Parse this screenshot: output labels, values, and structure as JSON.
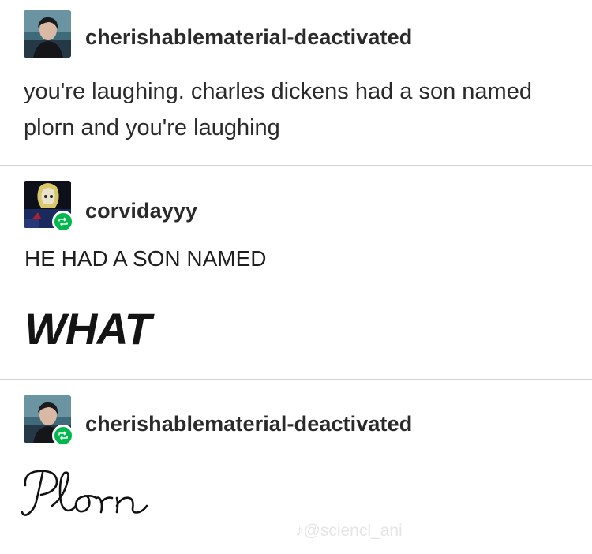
{
  "posts": [
    {
      "username": "cherishablematerial-deactivated",
      "avatar_icon": "person-portrait-avatar",
      "reblog": false,
      "body": "you're laughing. charles dickens had a son named plorn and you're laughing"
    },
    {
      "username": "corvidayyy",
      "avatar_icon": "character-portrait-avatar",
      "reblog": true,
      "body_line": "HE HAD A SON NAMED",
      "body_big": "WHAT"
    },
    {
      "username": "cherishablematerial-deactivated",
      "avatar_icon": "person-portrait-avatar",
      "reblog": true,
      "body_script": "Plorn"
    }
  ],
  "watermark": {
    "icon": "tiktok-icon",
    "text": "@sciencl_ani"
  },
  "colors": {
    "reblog_green": "#00b84e",
    "divider": "#d4d4d4",
    "text": "#222222"
  }
}
